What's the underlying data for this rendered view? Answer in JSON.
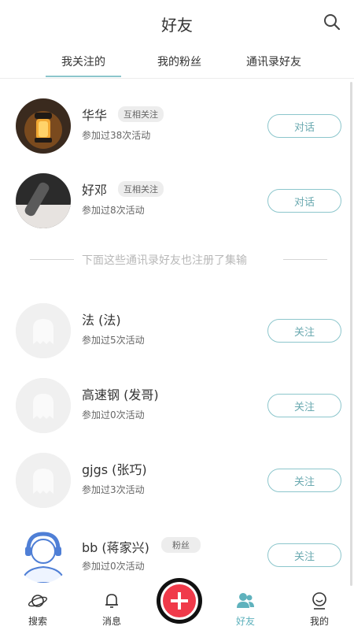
{
  "header": {
    "title": "好友"
  },
  "tabs": [
    {
      "label": "我关注的"
    },
    {
      "label": "我的粉丝"
    },
    {
      "label": "通讯录好友"
    }
  ],
  "following": [
    {
      "name": "华华",
      "badge": "互相关注",
      "activity": "参加过38次活动",
      "action": "对话"
    },
    {
      "name": "好邓",
      "badge": "互相关注",
      "activity": "参加过8次活动",
      "action": "对话"
    }
  ],
  "divider_text": "下面这些通讯录好友也注册了集输",
  "contacts": [
    {
      "name": "法 (法)",
      "activity": "参加过5次活动",
      "action": "关注"
    },
    {
      "name": "高速钢 (发哥)",
      "activity": "参加过0次活动",
      "action": "关注"
    },
    {
      "name": "gjgs (张巧)",
      "activity": "参加过3次活动",
      "action": "关注"
    },
    {
      "name": "bb (蒋家兴)",
      "badge": "粉丝",
      "activity": "参加过0次活动",
      "action": "关注"
    }
  ],
  "bottom_nav": [
    {
      "label": "搜索",
      "icon": "planet-icon"
    },
    {
      "label": "消息",
      "icon": "bell-icon"
    },
    {
      "label": "好友",
      "icon": "friends-icon",
      "active": true
    },
    {
      "label": "我的",
      "icon": "profile-icon"
    }
  ],
  "colors": {
    "accent": "#8cc6cc",
    "add_button": "#f03a4a"
  }
}
